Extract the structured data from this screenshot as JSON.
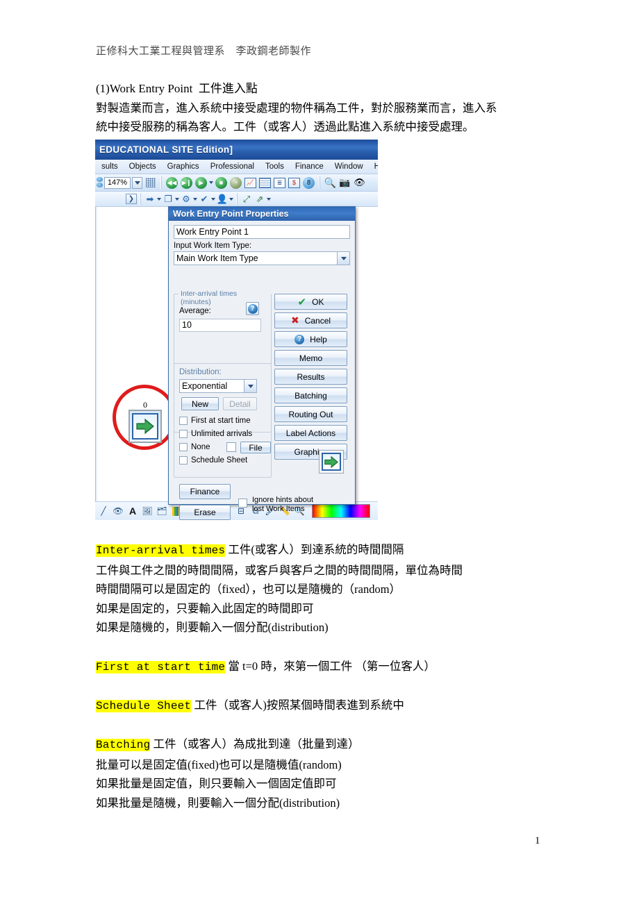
{
  "document": {
    "header": "正修科大工業工程與管理系　李政鋼老師製作",
    "title": "(1)Work Entry Point  工件進入點",
    "intro": [
      "對製造業而言，進入系統中接受處理的物件稱為工件，對於服務業而言，進入系",
      "統中接受服務的稱為客人。工件（或客人）透過此點進入系統中接受處理。"
    ],
    "page_number": "1",
    "sections": [
      {
        "keyword": "Inter-arrival times",
        "headline_rest": " 工件(或客人）到達系統的時間間隔",
        "lines": [
          "工件與工件之間的時間間隔，或客戶與客戶之間的時間間隔，單位為時間",
          "時間間隔可以是固定的（fixed），也可以是隨機的（random）",
          "如果是固定的，只要輸入此固定的時間即可",
          "如果是隨機的，則要輸入一個分配(distribution)"
        ]
      },
      {
        "keyword": "First at start time",
        "headline_rest": " 當 t=0 時，來第一個工件 （第一位客人）",
        "lines": []
      },
      {
        "keyword": "Schedule Sheet",
        "headline_rest": " 工件（或客人)按照某個時間表進到系統中",
        "lines": []
      },
      {
        "keyword": "Batching",
        "headline_rest": " 工件（或客人）為成批到達（批量到達）",
        "lines": [
          "批量可以是固定值(fixed)也可以是隨機值(random)",
          "如果批量是固定值，則只要輸入一個固定值即可",
          "如果批量是隨機，則要輸入一個分配(distribution)"
        ]
      }
    ],
    "highlight_color": "#ffff00"
  },
  "app": {
    "title_bar": "EDUCATIONAL SITE Edition]",
    "menu": [
      {
        "label": "sults",
        "accel": ""
      },
      {
        "label": "Objects",
        "accel": "O"
      },
      {
        "label": "Graphics",
        "accel": "G"
      },
      {
        "label": "Professional",
        "accel": "P"
      },
      {
        "label": "Tools",
        "accel": "s"
      },
      {
        "label": "Finance",
        "accel": "i"
      },
      {
        "label": "Window",
        "accel": "W"
      },
      {
        "label": "Help",
        "accel": "H"
      }
    ],
    "toolbar1": {
      "zoom_value": "147%",
      "icons": [
        "grid-icon",
        "rewind-icon",
        "step-icon",
        "play-icon",
        "play-dropdown-caret",
        "stop-icon",
        "clock-icon",
        "chart-icon",
        "table-icon",
        "report-icon",
        "currency-icon",
        "eight-icon",
        "zoom-icon",
        "camera-icon",
        "eye-icon"
      ]
    },
    "toolbar2": {
      "icons": [
        "expand-icon",
        "blue-arrow-icon",
        "copy-icon",
        "gear-icon",
        "check-icon",
        "person-icon",
        "link-icon",
        "route-icon"
      ]
    },
    "canvas": {
      "node_label": "0",
      "node_icon": "green-arrow-icon",
      "annotation": "red-circle-highlight"
    },
    "bottom_toolbar": {
      "icons": [
        "line-icon",
        "eye-icon",
        "text-icon",
        "image-icon",
        "layer-icon",
        "bars-icon",
        "grid-icon",
        "grid-caret",
        "table-icon",
        "rotate-icon",
        "align-icon",
        "mirror-icon",
        "brush-icon",
        "ruler-icon",
        "magnifier-icon"
      ],
      "palette": "rainbow-color-palette"
    }
  },
  "dialog": {
    "title": "Work Entry Point Properties",
    "name_value": "Work Entry Point 1",
    "input_type_label": "Input Work Item Type:",
    "input_type_value": "Main Work Item Type",
    "inter_arrival": {
      "legend": "Inter-arrival times (minutes)",
      "average_label": "Average:",
      "average_value": "10",
      "help_icon": "question-mark-icon"
    },
    "distribution": {
      "label": "Distribution:",
      "value": "Exponential",
      "new_button": "New",
      "detail_button": "Detail",
      "detail_disabled": true
    },
    "checkboxes": [
      {
        "label": "First at start time",
        "checked": false
      },
      {
        "label": "Unlimited arrivals",
        "checked": false
      },
      {
        "label": "None",
        "checked": false
      },
      {
        "label": "Schedule Sheet",
        "checked": false
      }
    ],
    "file_checkbox": {
      "label": "",
      "checked": false
    },
    "file_button": "File",
    "finance_button": "Finance",
    "erase_button": "Erase",
    "ignore_hints": {
      "line1": "Ignore hints about",
      "line2": "lost Work Items",
      "checked": false
    },
    "right_buttons": [
      {
        "label": "OK",
        "icon": "check-icon"
      },
      {
        "label": "Cancel",
        "icon": "x-icon"
      },
      {
        "label": "Help",
        "icon": "question-icon"
      },
      {
        "label": "Memo",
        "icon": ""
      },
      {
        "label": "Results",
        "icon": ""
      },
      {
        "label": "Batching",
        "icon": ""
      },
      {
        "label": "Routing Out",
        "icon": ""
      },
      {
        "label": "Label Actions",
        "icon": ""
      },
      {
        "label": "Graphics",
        "icon": ""
      }
    ],
    "flow_button_icon": "green-arrow-icon"
  }
}
